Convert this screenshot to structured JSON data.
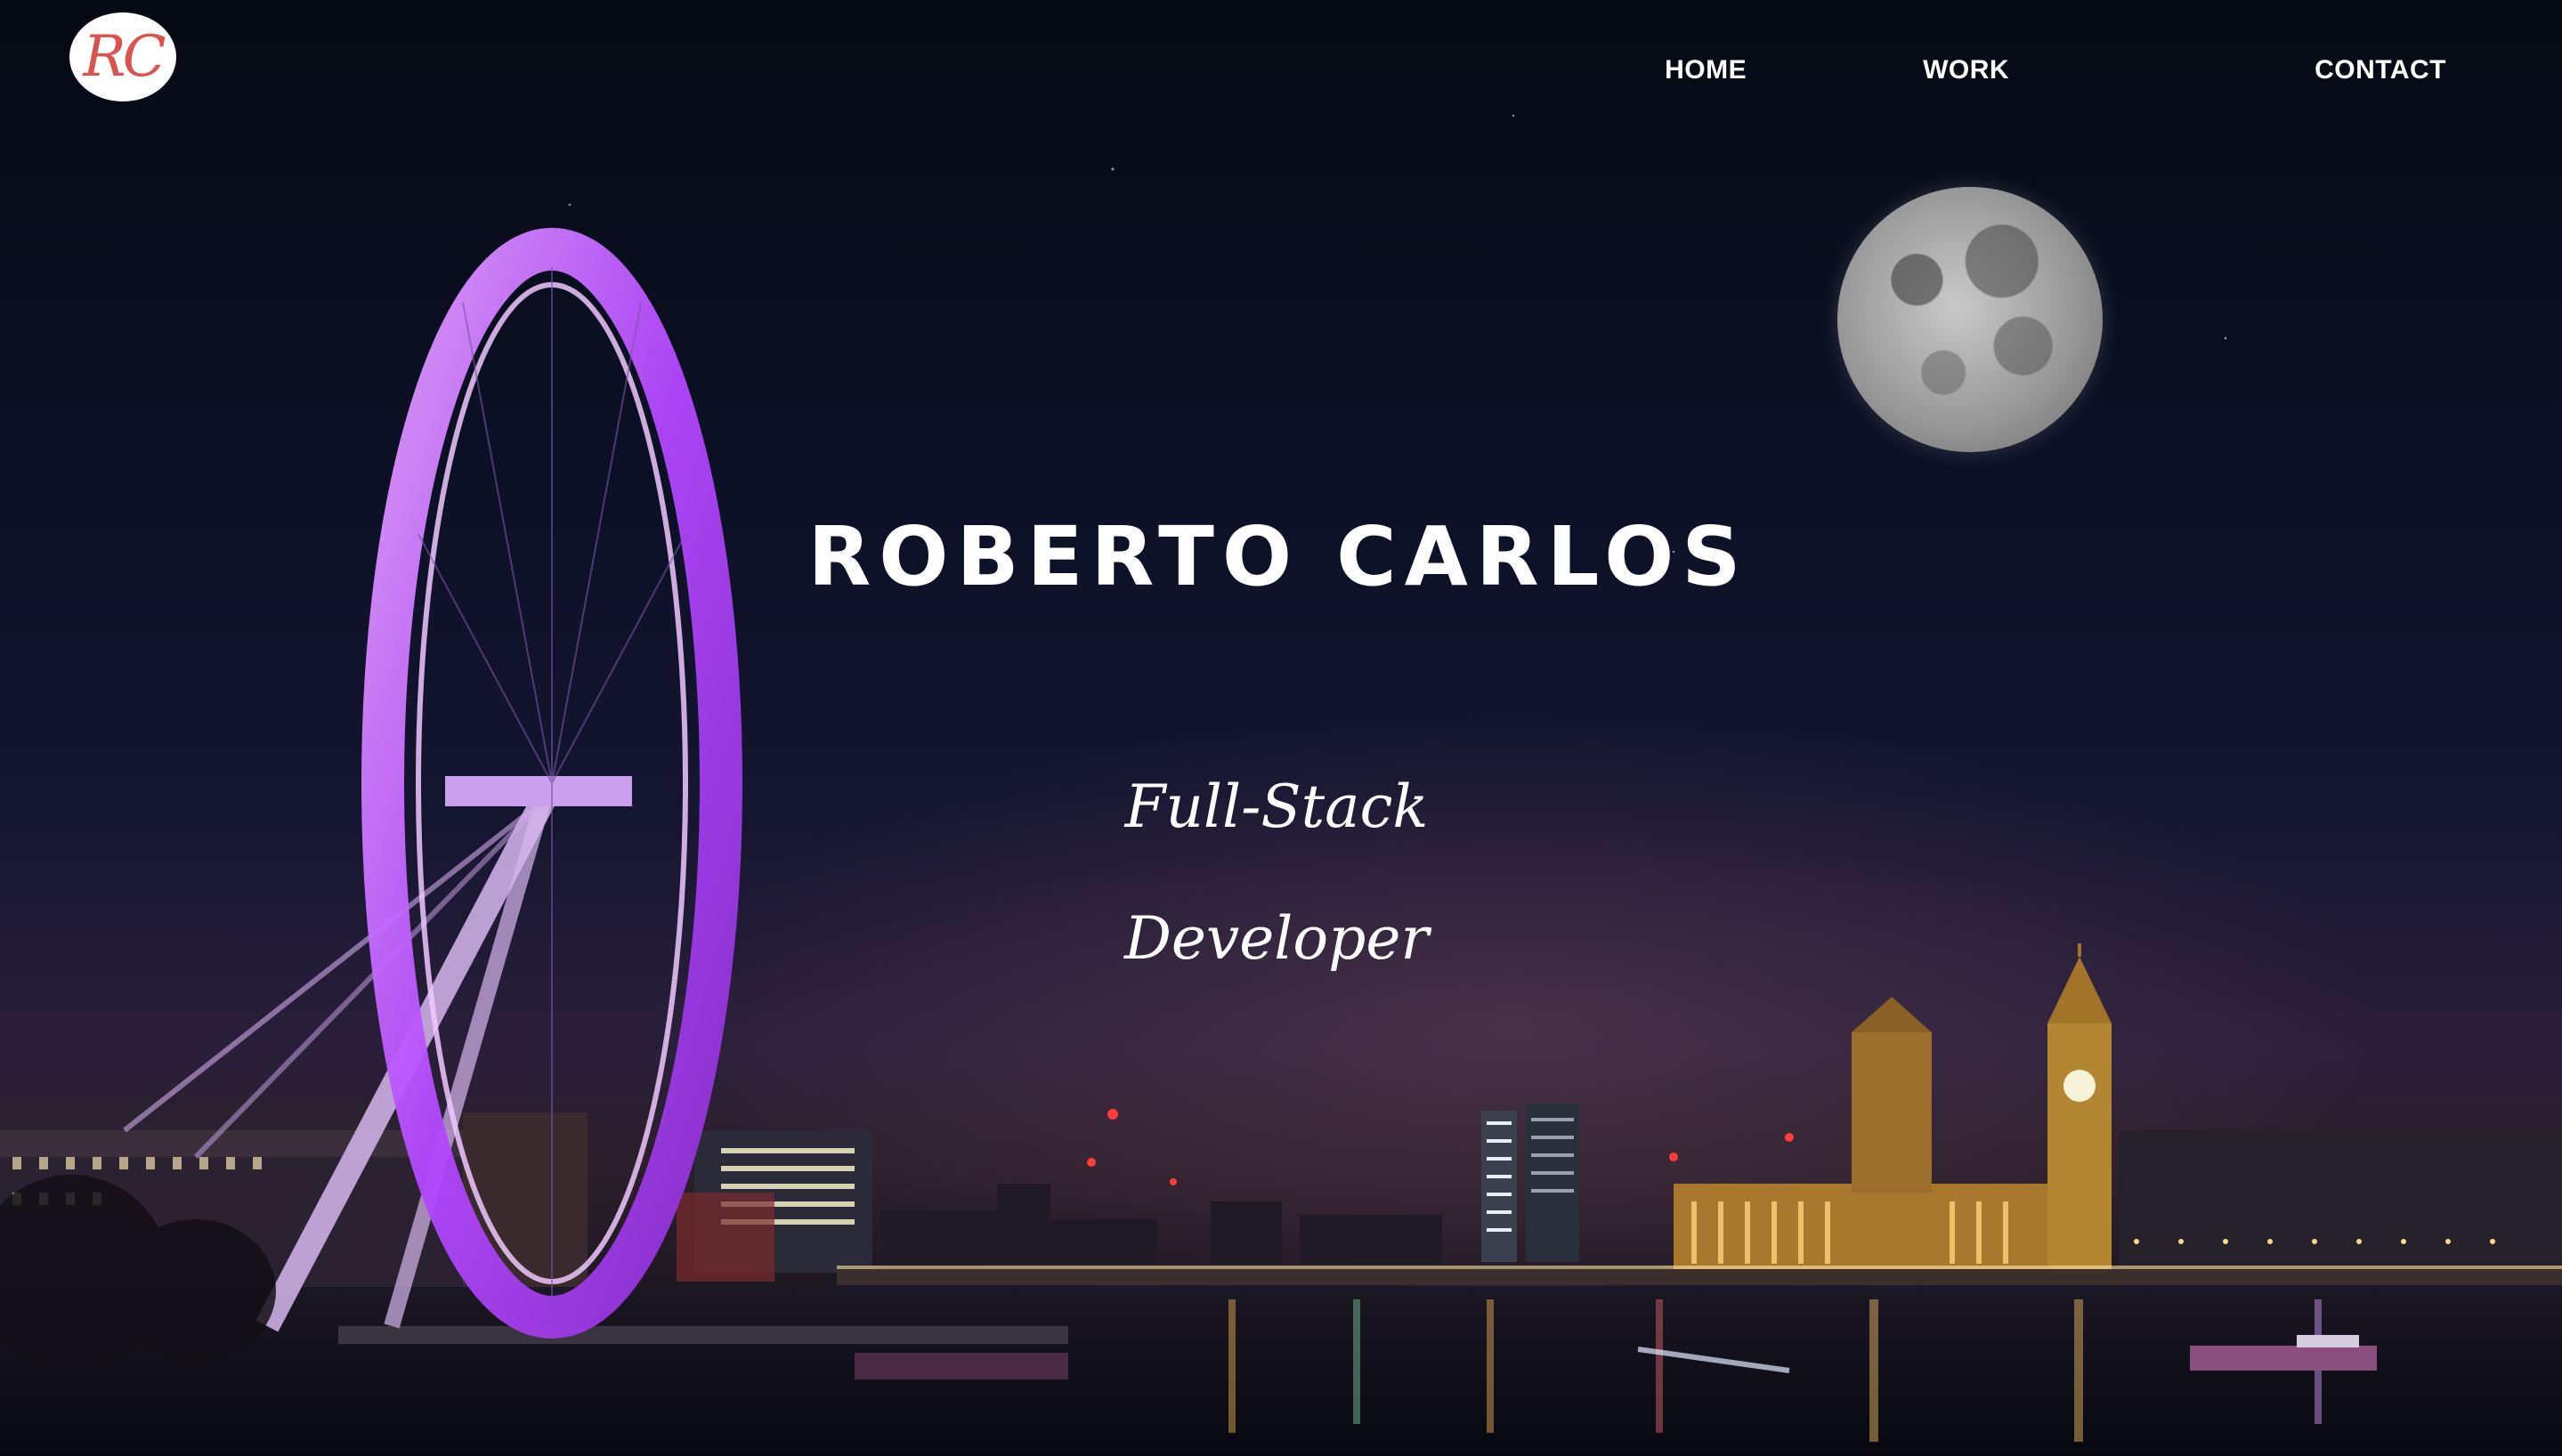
{
  "logo": {
    "text": "RC"
  },
  "nav": {
    "items": [
      {
        "label": "HOME"
      },
      {
        "label": "WORK"
      },
      {
        "label": "CONTACT"
      }
    ]
  },
  "hero": {
    "name": "ROBERTO CARLOS",
    "role_line_1": "Full-Stack",
    "role_line_2": "Developer"
  },
  "colors": {
    "logo_accent": "#d9534f",
    "ferris_wheel": "#c15cff",
    "text": "#ffffff"
  }
}
